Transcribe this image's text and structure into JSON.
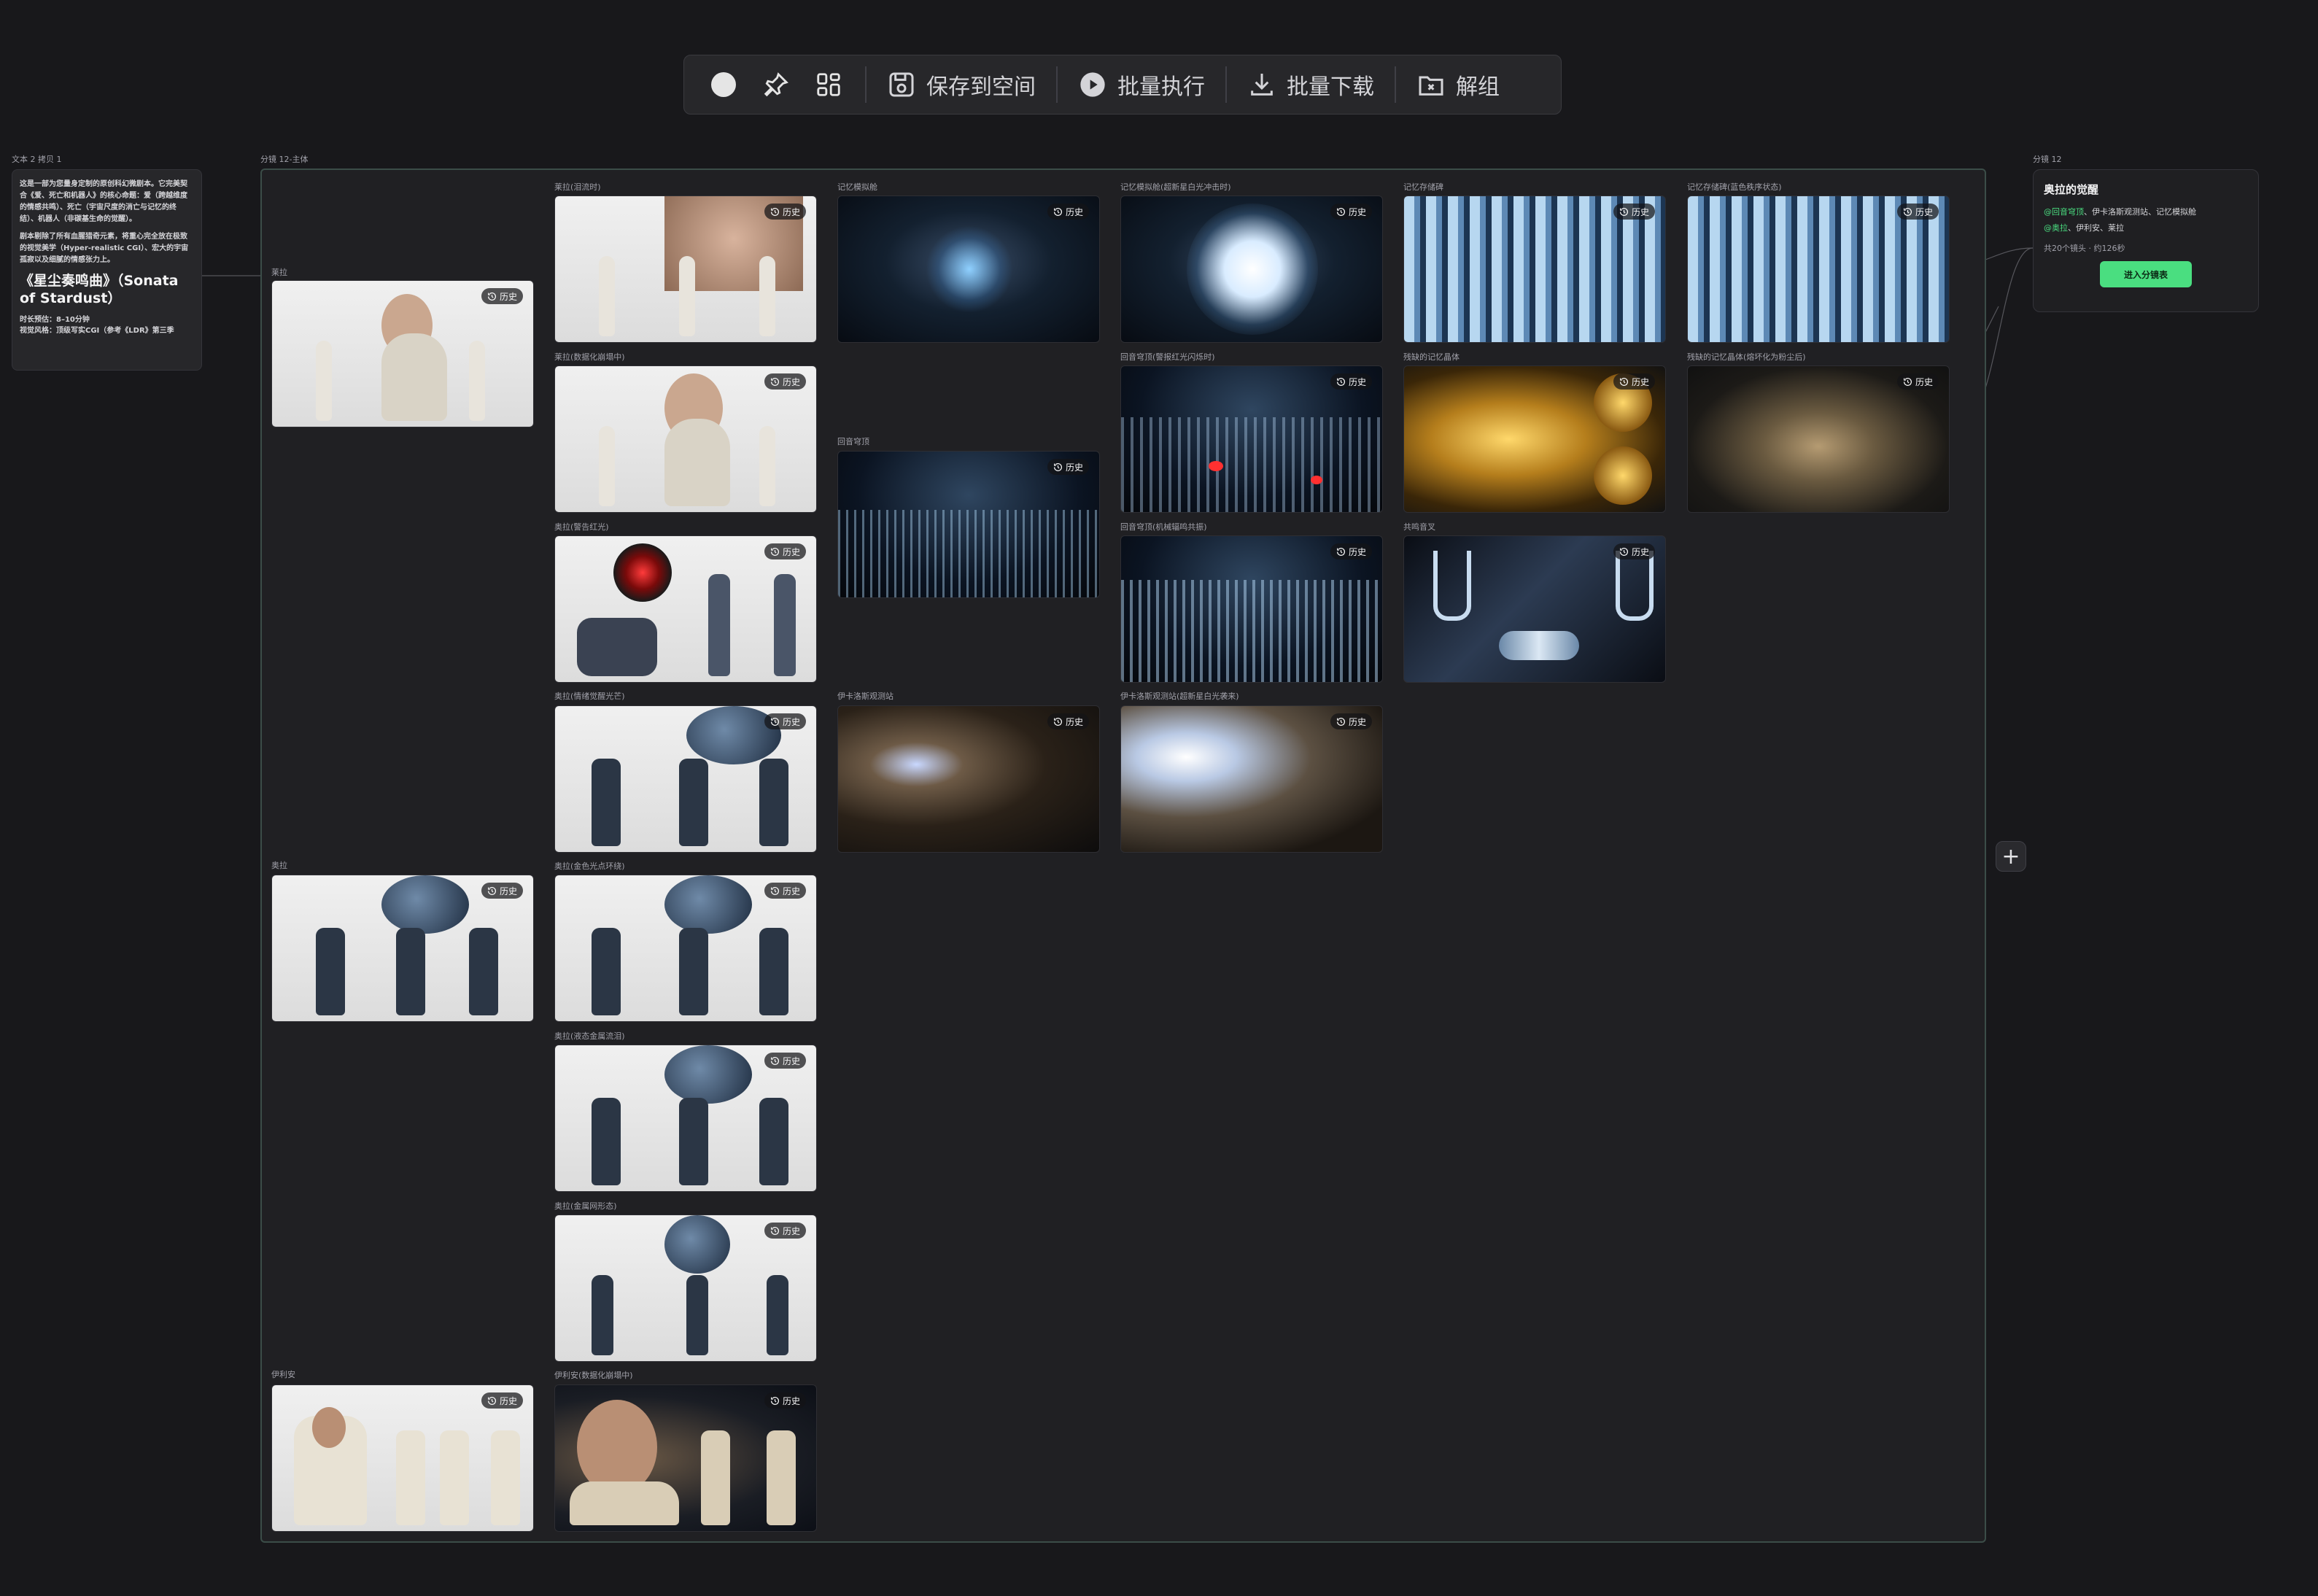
{
  "toolbar": {
    "save_label": "保存到空间",
    "run_label": "批量执行",
    "download_label": "批量下载",
    "ungroup_label": "解组"
  },
  "text_card": {
    "frame_label": "文本 2 拷贝 1",
    "paragraph1": "这是一部为您量身定制的原创科幻微剧本。它完美契合《爱、死亡和机器人》的核心命题：爱（跨越维度的情感共鸣）、死亡（宇宙尺度的消亡与记忆的终结）、机器人（非碳基生命的觉醒）。",
    "paragraph2": "剧本剔除了所有血腥猎奇元素，将重心完全放在极致的视觉美学（Hyper-realistic CGI）、宏大的宇宙孤寂以及细腻的情感张力上。",
    "title": "《星尘奏鸣曲》（Sonata of Stardust）",
    "duration": "时长预估：8–10分钟",
    "style": "视觉风格：顶级写实CGI（参考《LDR》第三季"
  },
  "group": {
    "label": "分镜 12-主体"
  },
  "history_label": "历史",
  "nodes": {
    "l_a": "莱拉",
    "l_b": "奥拉",
    "l_c": "伊利安",
    "c2_1": "莱拉(泪流时)",
    "c2_2": "莱拉(数据化崩塌中)",
    "c2_3": "奥拉(警告红光)",
    "c2_4": "奥拉(情绪觉醒光芒)",
    "c2_5": "奥拉(金色光点环绕)",
    "c2_6": "奥拉(液态金属流泪)",
    "c2_7": "奥拉(金属网形态)",
    "c2_8": "伊利安(数据化崩塌中)",
    "c3_1": "记忆模拟舱",
    "c3_2": "回音穹顶",
    "c3_3": "伊卡洛斯观测站",
    "c4_1": "记忆模拟舱(超新星白光冲击时)",
    "c4_2": "回音穹顶(警报红光闪烁时)",
    "c4_3": "回音穹顶(机械辐鸣共振)",
    "c4_4": "伊卡洛斯观测站(超新星白光袭来)",
    "c5_1": "记忆存储碑",
    "c5_2": "残缺的记忆晶体",
    "c5_3": "共鸣音叉",
    "c6_1": "记忆存储碑(蓝色秩序状态)",
    "c6_2": "残缺的记忆晶体(熔坏化为粉尘后)"
  },
  "scene_card": {
    "frame_label": "分镜 12",
    "title": "奥拉的觉醒",
    "line1_tag": "@回音穹顶",
    "line1_rest": "、伊卡洛斯观测站、记忆模拟舱",
    "line2_tag": "@奥拉",
    "line2_rest": "、伊利安、莱拉",
    "meta": "共20个镜头 · 约126秒",
    "button": "进入分镜表"
  }
}
